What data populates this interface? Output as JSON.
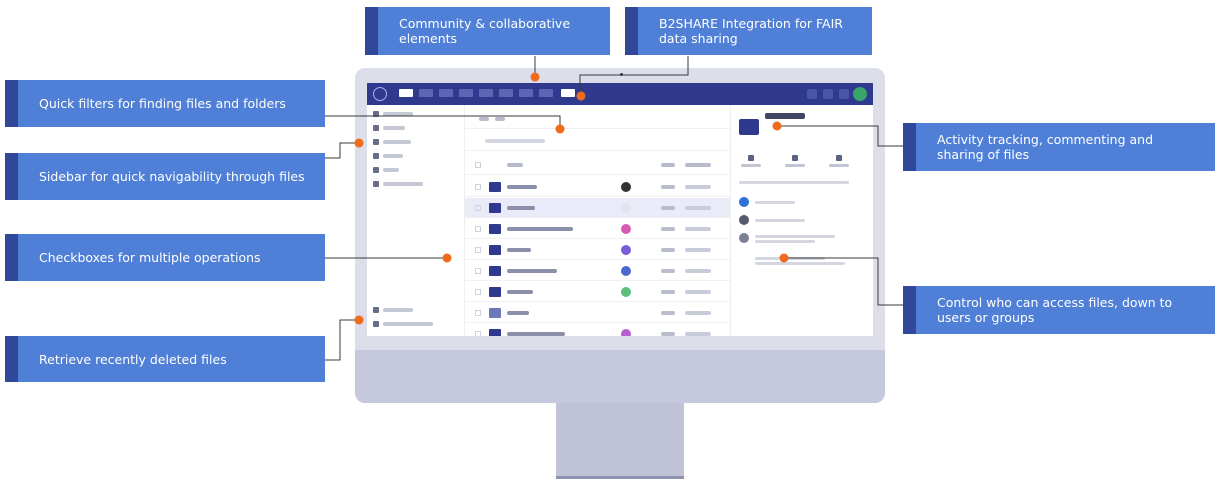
{
  "callouts": {
    "community": "Community & collaborative elements",
    "b2share": "B2SHARE Integration for FAIR data sharing",
    "quick_filters": "Quick filters for finding files and folders",
    "sidebar": "Sidebar for quick navigability through files",
    "checkboxes": "Checkboxes for multiple operations",
    "recently_deleted": "Retrieve recently deleted files",
    "activity": "Activity tracking, commenting and sharing of files",
    "access_control": "Control who can access files, down to users or groups"
  },
  "colors": {
    "callout_fill": "#4f7fd6",
    "callout_stripe": "#31489a",
    "connector_dot": "#ef6c1d",
    "app_topbar": "#2f3a8f",
    "monitor_body": "#dcdee9"
  },
  "icons": {
    "app_logo": "circle-logo-icon",
    "folder": "folder-icon",
    "avatar": "avatar-icon"
  }
}
